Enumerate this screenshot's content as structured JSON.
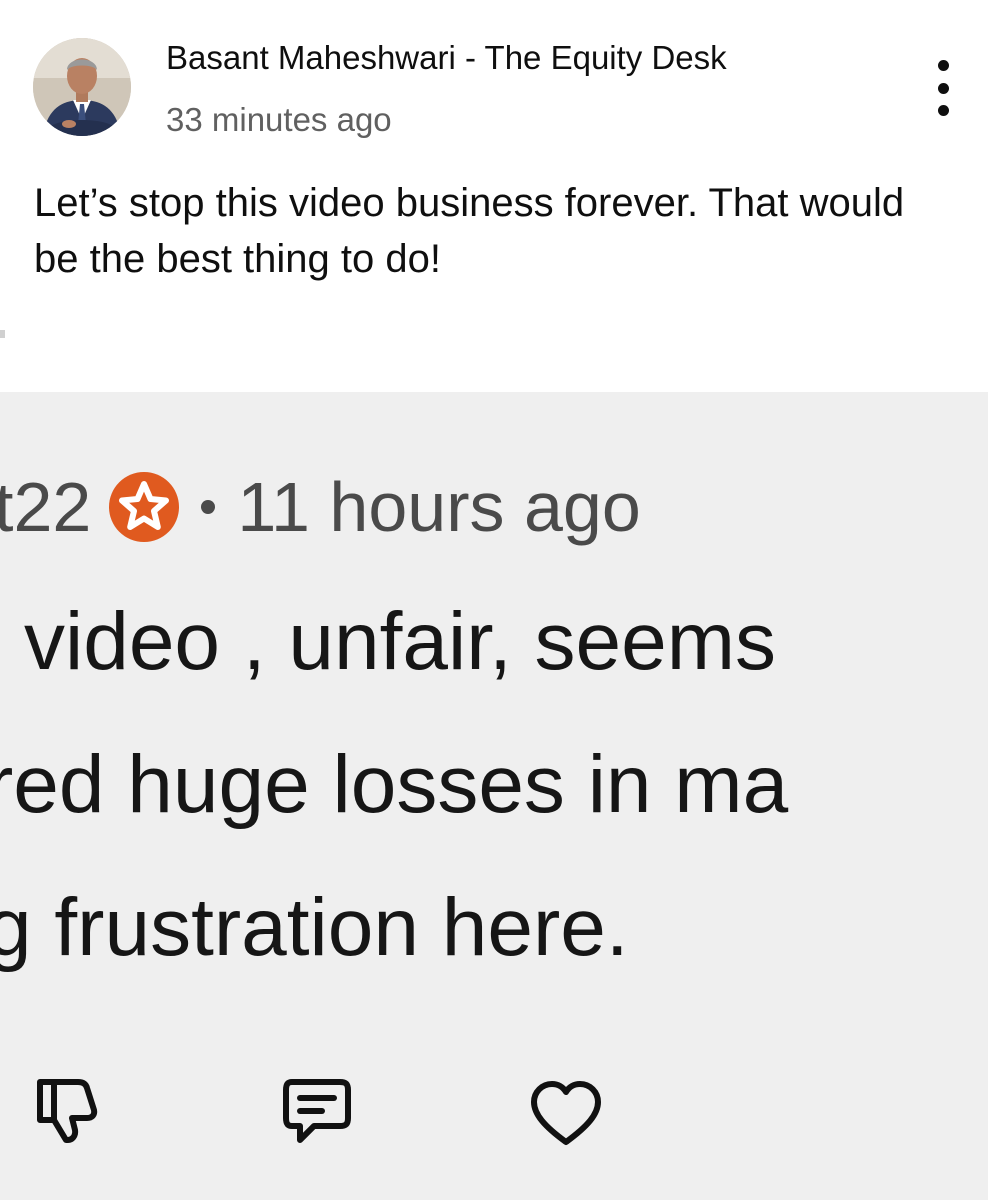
{
  "post": {
    "author": "Basant Maheshwari - The Equity Desk",
    "time": "33 minutes ago",
    "text": "Let’s stop this video business forever. That would be the best thing to do!"
  },
  "comment_screenshot": {
    "username_fragment": "t22",
    "time": "11 hours ago",
    "lines": [
      "video , unfair, seems",
      "red huge losses in ma",
      "g frustration here."
    ]
  },
  "icons": {
    "avatar": "author-avatar",
    "menu": "more-vert-icon",
    "badge": "star-badge-icon",
    "actions": [
      "thumbs-down-icon",
      "reply-comment-icon",
      "heart-icon"
    ]
  },
  "colors": {
    "badge": "#E05A1F",
    "screenshot_bg": "#EFEFEF",
    "secondary_text": "#606060"
  }
}
